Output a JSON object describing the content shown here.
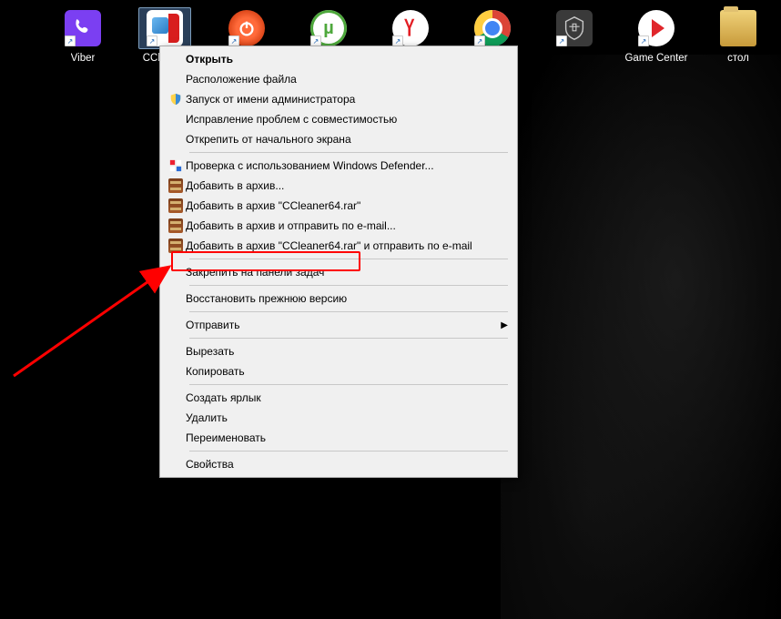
{
  "desktop": {
    "icons": [
      {
        "label": "Viber"
      },
      {
        "label": "CCleaner"
      },
      {
        "label": ""
      },
      {
        "label": ""
      },
      {
        "label": ""
      },
      {
        "label": ""
      },
      {
        "label": ""
      },
      {
        "label": "Game Center"
      },
      {
        "label": "стол"
      }
    ]
  },
  "context_menu": {
    "open": "Открыть",
    "file_location": "Расположение файла",
    "run_as_admin": "Запуск от имени администратора",
    "compatibility": "Исправление проблем с совместимостью",
    "unpin_start": "Открепить от начального экрана",
    "defender_scan": "Проверка с использованием Windows Defender...",
    "add_archive": "Добавить в архив...",
    "add_archive_named": "Добавить в архив \"CCleaner64.rar\"",
    "add_archive_email": "Добавить в архив и отправить по e-mail...",
    "add_archive_named_email": "Добавить в архив \"CCleaner64.rar\" и отправить по e-mail",
    "pin_taskbar": "Закрепить на панели задач",
    "restore_previous": "Восстановить прежнюю версию",
    "send_to": "Отправить",
    "cut": "Вырезать",
    "copy": "Копировать",
    "create_shortcut": "Создать ярлык",
    "delete": "Удалить",
    "rename": "Переименовать",
    "properties": "Свойства"
  }
}
